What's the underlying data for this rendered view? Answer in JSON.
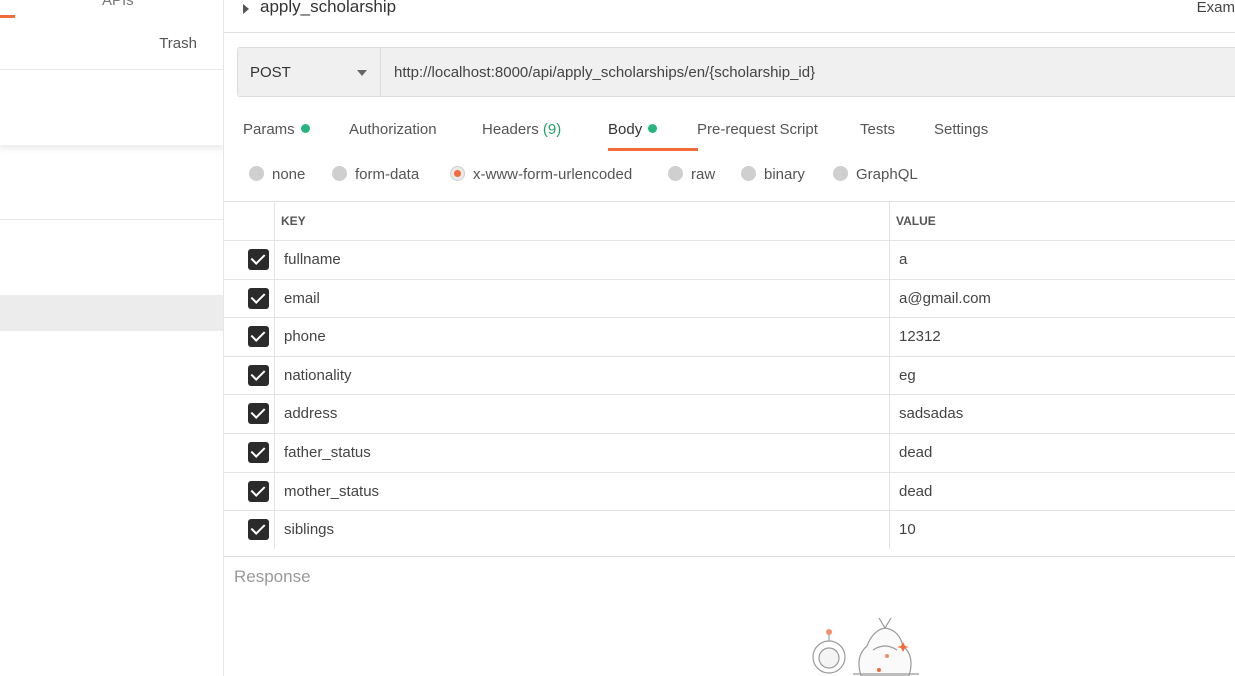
{
  "sidebar": {
    "top_tab_label": "APIs",
    "trash_label": "Trash"
  },
  "request": {
    "name": "apply_scholarship",
    "examples_label": "Exam",
    "method": "POST",
    "url": "http://localhost:8000/api/apply_scholarships/en/{scholarship_id}"
  },
  "tabs": {
    "params": "Params",
    "authorization": "Authorization",
    "headers": "Headers",
    "headers_count": "(9)",
    "body": "Body",
    "prerequest": "Pre-request Script",
    "tests": "Tests",
    "settings": "Settings"
  },
  "body_modes": {
    "none": "none",
    "form_data": "form-data",
    "urlencoded": "x-www-form-urlencoded",
    "raw": "raw",
    "binary": "binary",
    "graphql": "GraphQL",
    "selected": "x-www-form-urlencoded"
  },
  "table": {
    "key_header": "KEY",
    "value_header": "VALUE",
    "rows": [
      {
        "key": "fullname",
        "value": "a"
      },
      {
        "key": "email",
        "value": "a@gmail.com"
      },
      {
        "key": "phone",
        "value": "12312"
      },
      {
        "key": "nationality",
        "value": "eg"
      },
      {
        "key": "address",
        "value": "sadsadas"
      },
      {
        "key": "father_status",
        "value": "dead"
      },
      {
        "key": "mother_status",
        "value": "dead"
      },
      {
        "key": "siblings",
        "value": "10"
      }
    ]
  },
  "response": {
    "label": "Response"
  },
  "colors": {
    "accent": "#f26b3a",
    "status_dot": "#26b47f"
  }
}
